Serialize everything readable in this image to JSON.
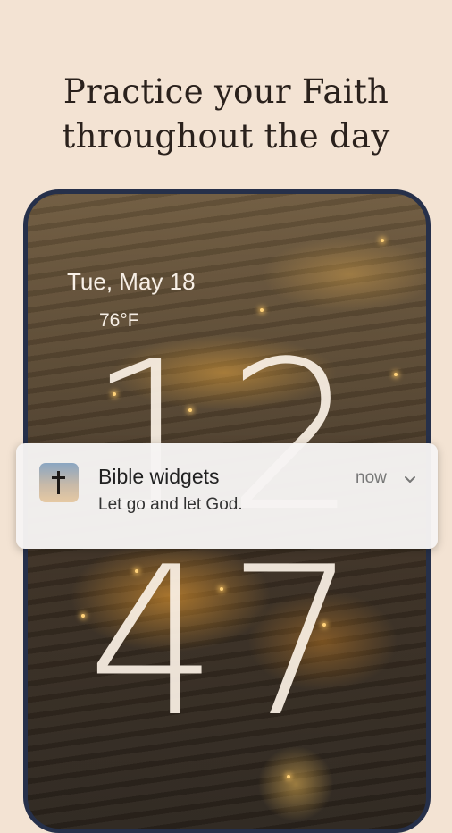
{
  "headline": {
    "line1": "Practice your Faith",
    "line2": "throughout the day"
  },
  "lockscreen": {
    "date": "Tue, May 18",
    "temperature": "76°F",
    "clock": {
      "hours": "12",
      "minutes": "47"
    }
  },
  "notification": {
    "app_icon": "cross-icon",
    "app_name": "Bible widgets",
    "time": "now",
    "message": "Let go and let God.",
    "expand_icon": "chevron-down-icon"
  },
  "colors": {
    "background": "#f3e3d3",
    "phone_frame": "#26304a",
    "headline_text": "#2a211c"
  }
}
